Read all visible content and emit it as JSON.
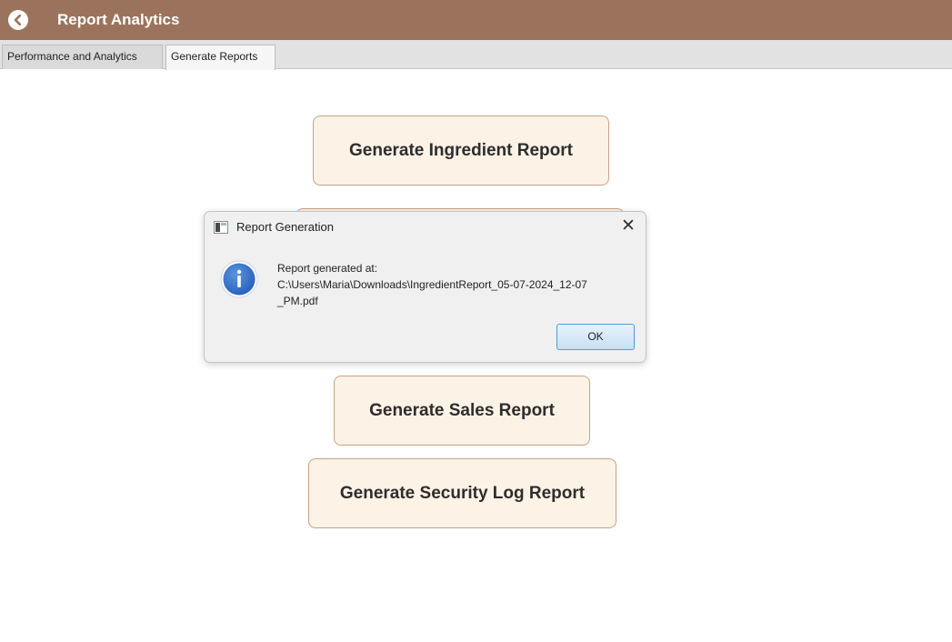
{
  "header": {
    "title": "Report Analytics",
    "back_icon": "chevron-left-icon"
  },
  "tabs": [
    {
      "label": "Performance and Analytics",
      "selected": false
    },
    {
      "label": "Generate Reports",
      "selected": true
    }
  ],
  "buttons": {
    "ingredient": "Generate Ingredient Report",
    "sales": "Generate Sales Report",
    "security": "Generate Security Log Report"
  },
  "dialog": {
    "title": "Report Generation",
    "icon": "info-icon",
    "message_line1": "Report generated at:",
    "message_line2": "C:\\Users\\Maria\\Downloads\\IngredientReport_05-07-2024_12-07",
    "message_line3": "_PM.pdf",
    "ok_label": "OK",
    "close_glyph": "✕"
  },
  "colors": {
    "header": "#9b735c",
    "button_bg": "#fdf2e6",
    "button_border": "#c8a288",
    "dialog_bg": "#f0f0f0",
    "info_blue": "#2f6ec8"
  }
}
